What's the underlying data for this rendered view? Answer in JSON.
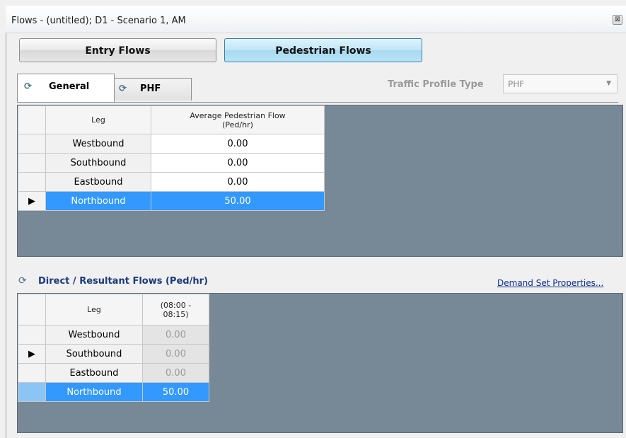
{
  "window": {
    "title": "Flows - (untitled); D1 - Scenario 1, AM",
    "close_glyph": "⊠"
  },
  "mode_buttons": {
    "entry_flows": "Entry Flows",
    "pedestrian_flows": "Pedestrian Flows"
  },
  "tabs": [
    {
      "label": "General",
      "icon": "tab-settings-icon"
    },
    {
      "label": "PHF",
      "icon": "tab-settings-icon"
    }
  ],
  "traffic_profile": {
    "label": "Traffic Profile Type",
    "value": "PHF"
  },
  "general_grid": {
    "columns": [
      "Leg",
      "Average Pedestrian Flow (Ped/hr)"
    ],
    "rows": [
      {
        "leg": "Westbound",
        "value": "0.00"
      },
      {
        "leg": "Southbound",
        "value": "0.00"
      },
      {
        "leg": "Eastbound",
        "value": "0.00"
      },
      {
        "leg": "Northbound",
        "value": "50.00"
      }
    ],
    "selected_row": 3
  },
  "direct_section": {
    "title": "Direct / Resultant Flows (Ped/hr)",
    "link": "Demand Set Properties..."
  },
  "direct_grid": {
    "columns": [
      "Leg",
      "(08:00 - 08:15)"
    ],
    "rows": [
      {
        "leg": "Westbound",
        "value": "0.00"
      },
      {
        "leg": "Southbound",
        "value": "0.00"
      },
      {
        "leg": "Eastbound",
        "value": "0.00"
      },
      {
        "leg": "Northbound",
        "value": "50.00"
      }
    ],
    "selected_row": 3
  },
  "colors": {
    "selection": "#3399ff",
    "grid_background": "#778896",
    "section_title": "#1a3a7a"
  }
}
